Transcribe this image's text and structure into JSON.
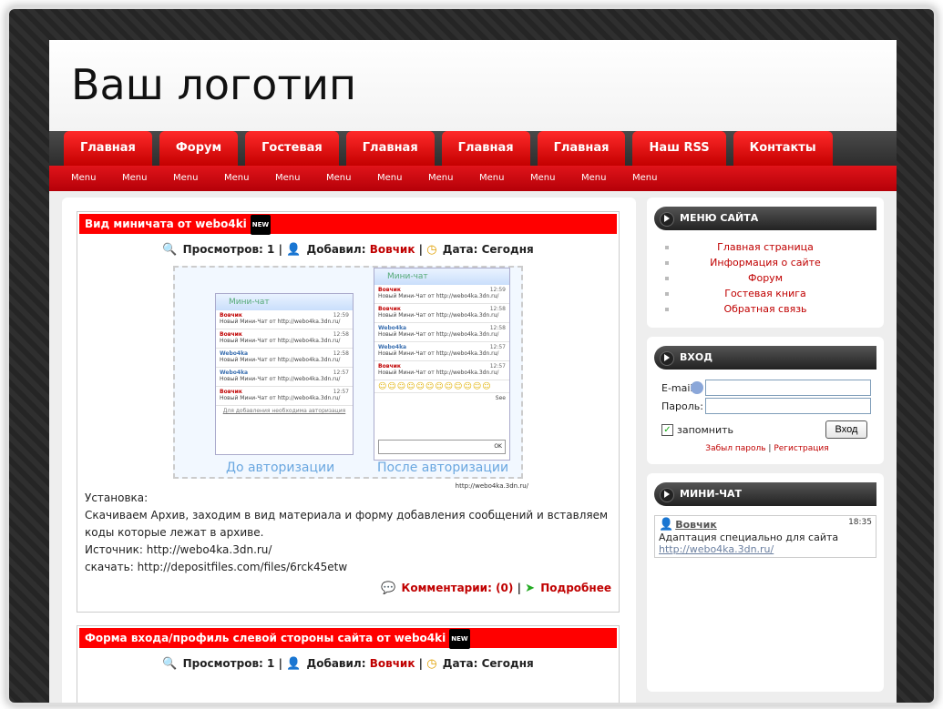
{
  "logo": "Ваш логотип",
  "nav": {
    "tabs": [
      "Главная",
      "Форум",
      "Гостевая",
      "Главная",
      "Главная",
      "Главная",
      "Наш RSS",
      "Контакты"
    ],
    "submenu": [
      "Menu",
      "Menu",
      "Menu",
      "Menu",
      "Menu",
      "Menu",
      "Menu",
      "Menu",
      "Menu",
      "Menu",
      "Menu",
      "Menu"
    ]
  },
  "posts": [
    {
      "title": "Вид миничата от webo4ki",
      "badge": "NEW",
      "views_label": "Просмотров:",
      "views": "1",
      "added_label": "Добавил:",
      "author": "Вовчик",
      "date_label": "Дата:",
      "date": "Сегодня",
      "screenshot": {
        "left_header": "Мини-чат",
        "right_header": "Мини-чат",
        "left_caption": "До авторизации",
        "right_caption": "После авторизации",
        "watermark": "http://webo4ka.3dn.ru/",
        "msg_user_a": "Вовчик",
        "msg_user_b": "Webo4ka",
        "msg_text": "Новый Мини-Чат от http://webo4ka.3dn.ru/",
        "times": [
          "12:59",
          "12:58",
          "12:58",
          "12:57",
          "12:57"
        ],
        "register_note": "Для добавления необходима авторизация",
        "ok": "OK",
        "see": "See"
      },
      "text": {
        "line1": "Установка:",
        "line2": "Скачиваем Архив, заходим в вид материала и форму добавления сообщений и вставляем коды которые лежат в архиве.",
        "line3": "Источник: http://webo4ka.3dn.ru/",
        "line4": "скачать: http://depositfiles.com/files/6rck45etw"
      },
      "comments": "Комментарии: (0)",
      "more": "Подробнее"
    },
    {
      "title": "Форма входа/профиль слевой стороны сайта от webo4ki",
      "badge": "NEW",
      "views_label": "Просмотров:",
      "views": "1",
      "added_label": "Добавил:",
      "author": "Вовчик",
      "date_label": "Дата:",
      "date": "Сегодня"
    }
  ],
  "sidebar": {
    "menu": {
      "title": "МЕНЮ САЙТА",
      "items": [
        "Главная страница",
        "Информация о сайте",
        "Форум",
        "Гостевая книга",
        "Обратная связь"
      ]
    },
    "login": {
      "title": "ВХОД",
      "email_label": "E-mail:",
      "password_label": "Пароль:",
      "remember_label": "запомнить",
      "button": "Вход",
      "forgot": "Забыл пароль",
      "separator": "|",
      "register": "Регистрация"
    },
    "chat": {
      "title": "МИНИ-ЧАТ",
      "user": "Вовчик",
      "time": "18:35",
      "message": "Адаптация специально для сайта",
      "link": "http://webo4ka.3dn.ru/"
    }
  }
}
